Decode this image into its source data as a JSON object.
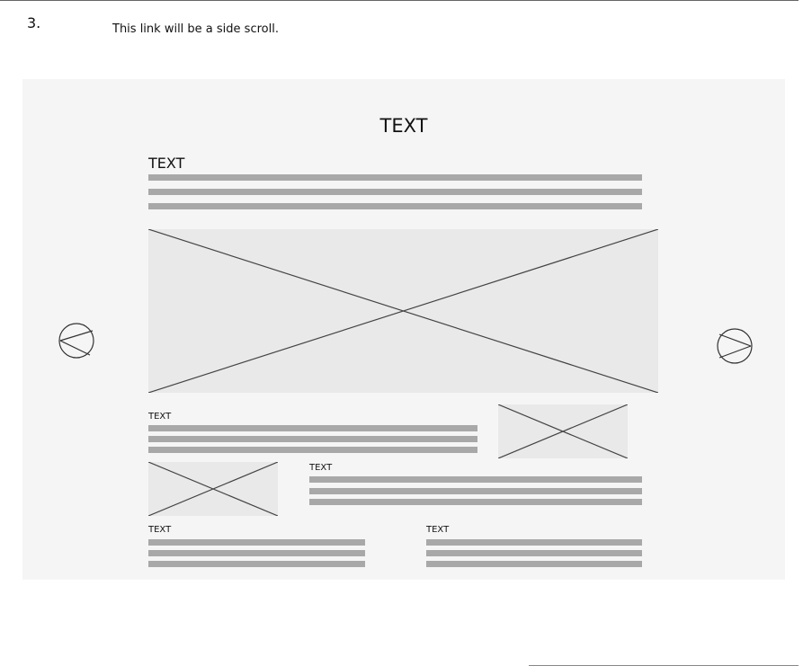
{
  "step": {
    "number": "3."
  },
  "note": {
    "text": "This link will be a side scroll."
  },
  "wireframe": {
    "title": "TEXT",
    "intro": {
      "heading": "TEXT"
    },
    "block_a": {
      "heading": "TEXT"
    },
    "block_b": {
      "heading": "TEXT"
    },
    "block_c": {
      "heading": "TEXT"
    },
    "block_d": {
      "heading": "TEXT"
    },
    "nav": {
      "prev_icon": "circle-left-arrow-icon",
      "next_icon": "circle-right-arrow-icon"
    }
  }
}
